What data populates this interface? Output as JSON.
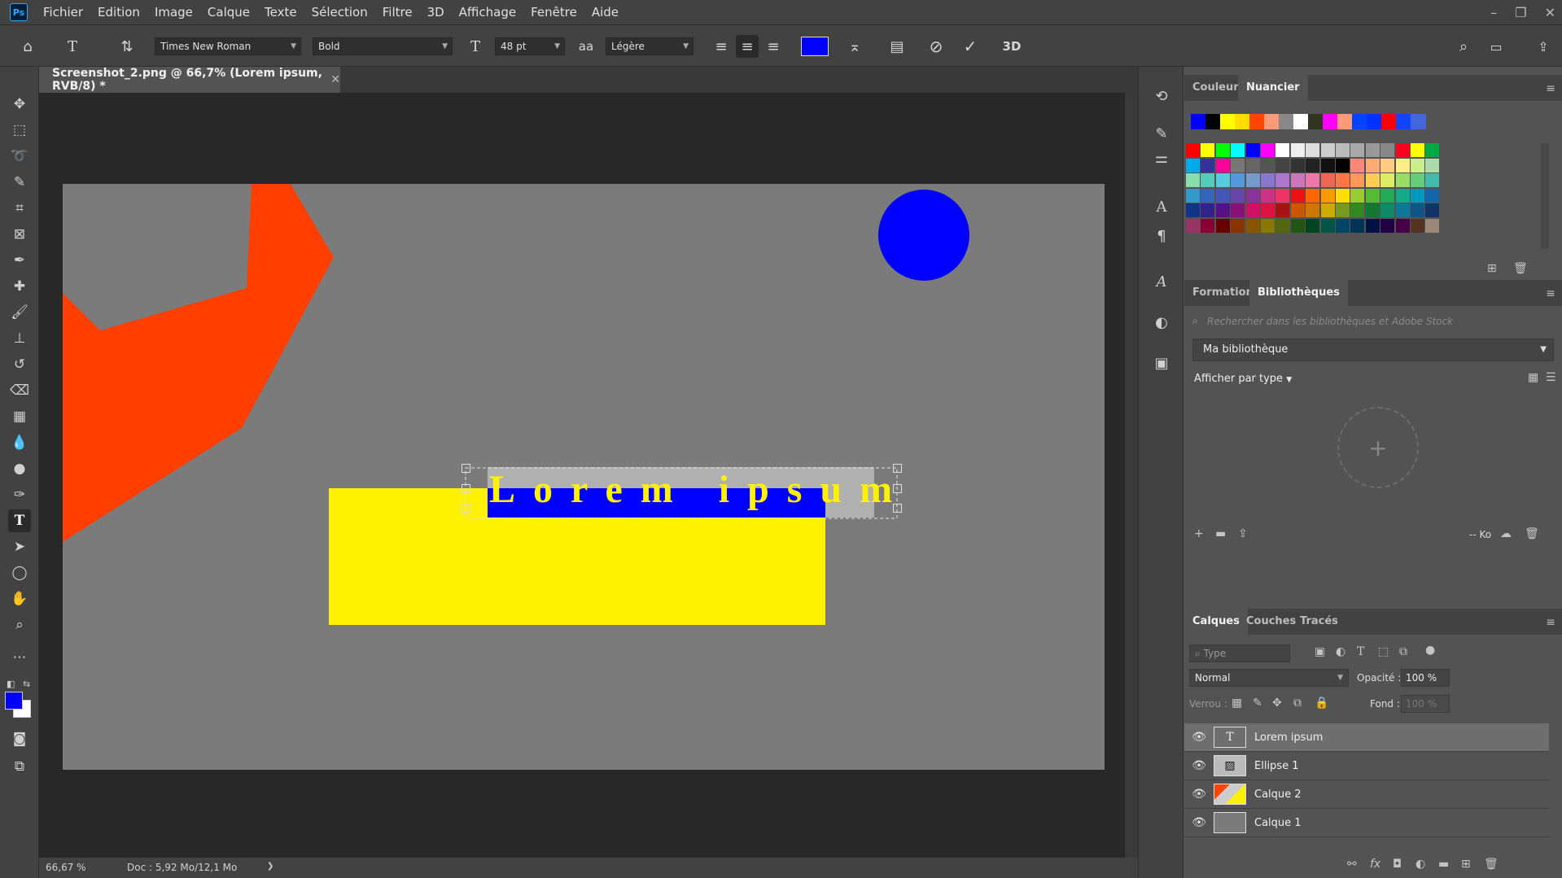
{
  "app": {
    "logo": "Ps"
  },
  "menu": [
    "Fichier",
    "Edition",
    "Image",
    "Calque",
    "Texte",
    "Sélection",
    "Filtre",
    "3D",
    "Affichage",
    "Fenêtre",
    "Aide"
  ],
  "options": {
    "font_family": "Times New Roman",
    "font_style": "Bold",
    "font_size": "48 pt",
    "aa_label": "aa",
    "antialias": "Légère",
    "color": "#0000ff",
    "btn_3d": "3D"
  },
  "document": {
    "tab_title": "Screenshot_2.png @ 66,7% (Lorem ipsum, RVB/8) *",
    "text_layer_content": "Lorem ipsum",
    "zoom": "66,67 %",
    "doc_info": "Doc : 5,92 Mo/12,1 Mo",
    "status_arrow": "❯"
  },
  "colors": {
    "canvas_bg": "#7b7b7b",
    "orange": "#ff3f00",
    "blue": "#0000ff",
    "yellow": "#fff200",
    "foreground": "#0000ff",
    "background": "#ffffff"
  },
  "swatch_panel": {
    "tabs": [
      "Couleur",
      "Nuancier"
    ],
    "active_tab": "Nuancier",
    "recent": [
      "#0000ff",
      "#000000",
      "#ffff00",
      "#ffdd00",
      "#ff4400",
      "#ff9977",
      "#888888",
      "#ffffff",
      "#333322",
      "#ff00ff",
      "#ff9977",
      "#0044ff",
      "#0033ff",
      "#ff0000",
      "#1144ff",
      "#4466dd"
    ],
    "grid": [
      [
        "#ff0000",
        "#ffff00",
        "#00ff00",
        "#00ffff",
        "#0000ff",
        "#ff00ff",
        "#ffffff",
        "#eeeeee",
        "#dddddd",
        "#cccccc",
        "#bbbbbb",
        "#aaaaaa",
        "#999999",
        "#888888",
        "#ff0022",
        "#ffff00",
        "#00aa44"
      ],
      [
        "#00aaee",
        "#333399",
        "#ff0099",
        "#777777",
        "#666666",
        "#555555",
        "#444444",
        "#333333",
        "#222222",
        "#111111",
        "#000000",
        "#ff8877",
        "#ffaa77",
        "#ffcc88",
        "#ffee88",
        "#ccee88",
        "#aaddaa"
      ],
      [
        "#88ddaa",
        "#55ccbb",
        "#55ccdd",
        "#5599dd",
        "#7799cc",
        "#8877cc",
        "#aa77cc",
        "#cc77bb",
        "#ee77aa",
        "#ee6655",
        "#ff7744",
        "#ff9955",
        "#ffcc55",
        "#ddee66",
        "#99dd66",
        "#66cc77",
        "#44bbaa"
      ],
      [
        "#3399cc",
        "#3366bb",
        "#4455bb",
        "#6644aa",
        "#883399",
        "#cc3388",
        "#ee3366",
        "#ee1111",
        "#ff6600",
        "#ff9900",
        "#ffdd00",
        "#99cc33",
        "#55bb33",
        "#22aa55",
        "#11aa88",
        "#0099bb",
        "#1166aa"
      ],
      [
        "#113388",
        "#332288",
        "#551188",
        "#881177",
        "#cc1166",
        "#dd1144",
        "#aa1111",
        "#cc5500",
        "#cc7700",
        "#ccaa00",
        "#779922",
        "#338822",
        "#117733",
        "#118866",
        "#117799",
        "#115588",
        "#113366"
      ],
      [
        "#993366",
        "#880033",
        "#660000",
        "#883300",
        "#885500",
        "#887700",
        "#556611",
        "#225511",
        "#004422",
        "#005544",
        "#004466",
        "#003355",
        "#001144",
        "#220044",
        "#440044",
        "#553322",
        "#998877"
      ]
    ]
  },
  "library_panel": {
    "tabs": [
      "Formation",
      "Bibliothèques"
    ],
    "active_tab": "Bibliothèques",
    "search_placeholder": "Rechercher dans les bibliothèques et Adobe Stock",
    "library_name": "Ma bibliothèque",
    "view_by": "Afficher par type",
    "size_label": "-- Ko"
  },
  "layers_panel": {
    "tabs": [
      "Calques",
      "Couches",
      "Tracés"
    ],
    "active_tab": "Calques",
    "filter_placeholder": "Type",
    "blend_mode": "Normal",
    "opacity_label": "Opacité :",
    "opacity_value": "100 %",
    "lock_label": "Verrou :",
    "fill_label": "Fond :",
    "fill_value": "100 %",
    "layers": [
      {
        "name": "Lorem ipsum",
        "type": "text",
        "selected": true
      },
      {
        "name": "Ellipse 1",
        "type": "shape",
        "selected": false
      },
      {
        "name": "Calque 2",
        "type": "raster",
        "selected": false
      },
      {
        "name": "Calque 1",
        "type": "raster",
        "selected": false
      }
    ]
  }
}
